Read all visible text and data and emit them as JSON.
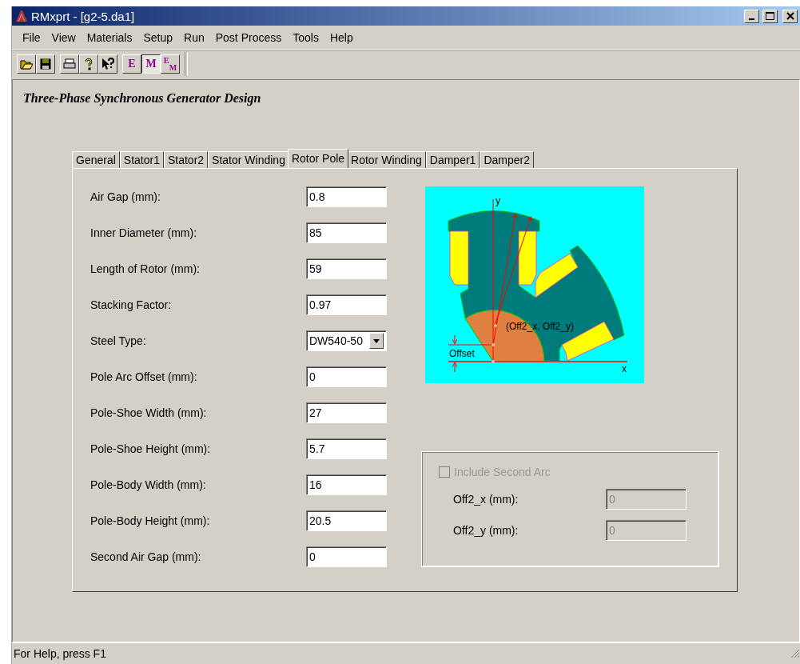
{
  "window": {
    "title": "RMxprt - [g2-5.da1]"
  },
  "menu": [
    "File",
    "View",
    "Materials",
    "Setup",
    "Run",
    "Post Process",
    "Tools",
    "Help"
  ],
  "toolbar": [
    {
      "kind": "open",
      "pressed": false
    },
    {
      "kind": "save",
      "pressed": false
    },
    {
      "kind": "print",
      "pressed": false
    },
    {
      "kind": "help",
      "pressed": false
    },
    {
      "kind": "context-help",
      "pressed": false
    },
    {
      "kind": "letter",
      "label": "E",
      "pressed": false
    },
    {
      "kind": "letter",
      "label": "M",
      "pressed": true
    },
    {
      "kind": "pair",
      "label": "E",
      "sub": "M",
      "pressed": false
    }
  ],
  "heading": "Three-Phase Synchronous Generator Design",
  "tabs": [
    {
      "label": "General",
      "selected": false
    },
    {
      "label": "Stator1",
      "selected": false
    },
    {
      "label": "Stator2",
      "selected": false
    },
    {
      "label": "Stator Winding",
      "selected": false
    },
    {
      "label": "Rotor Pole",
      "selected": true
    },
    {
      "label": "Rotor Winding",
      "selected": false
    },
    {
      "label": "Damper1",
      "selected": false
    },
    {
      "label": "Damper2",
      "selected": false
    }
  ],
  "fields": [
    {
      "label": "Air Gap (mm):",
      "value": "0.8",
      "kind": "text"
    },
    {
      "label": "Inner Diameter (mm):",
      "value": "85",
      "kind": "text"
    },
    {
      "label": "Length of Rotor (mm):",
      "value": "59",
      "kind": "text"
    },
    {
      "label": "Stacking Factor:",
      "value": "0.97",
      "kind": "text"
    },
    {
      "label": "Steel Type:",
      "value": "DW540-50",
      "kind": "select"
    },
    {
      "label": "Pole Arc Offset (mm):",
      "value": "0",
      "kind": "text"
    },
    {
      "label": "Pole-Shoe Width (mm):",
      "value": "27",
      "kind": "text"
    },
    {
      "label": "Pole-Shoe Height (mm):",
      "value": "5.7",
      "kind": "text"
    },
    {
      "label": "Pole-Body Width (mm):",
      "value": "16",
      "kind": "text"
    },
    {
      "label": "Pole-Body Height (mm):",
      "value": "20.5",
      "kind": "text"
    },
    {
      "label": "Second Air Gap (mm):",
      "value": "0",
      "kind": "text"
    }
  ],
  "diagram": {
    "y_axis": "y",
    "x_axis": "x",
    "offset": "Offset",
    "point": "(Off2_x, Off2_y)"
  },
  "second_arc": {
    "label": "Include Second Arc",
    "checked": false,
    "disabled": true,
    "fields": [
      {
        "label": "Off2_x (mm):",
        "value": "0"
      },
      {
        "label": "Off2_y (mm):",
        "value": "0"
      }
    ]
  },
  "status_bar": "For Help, press F1"
}
